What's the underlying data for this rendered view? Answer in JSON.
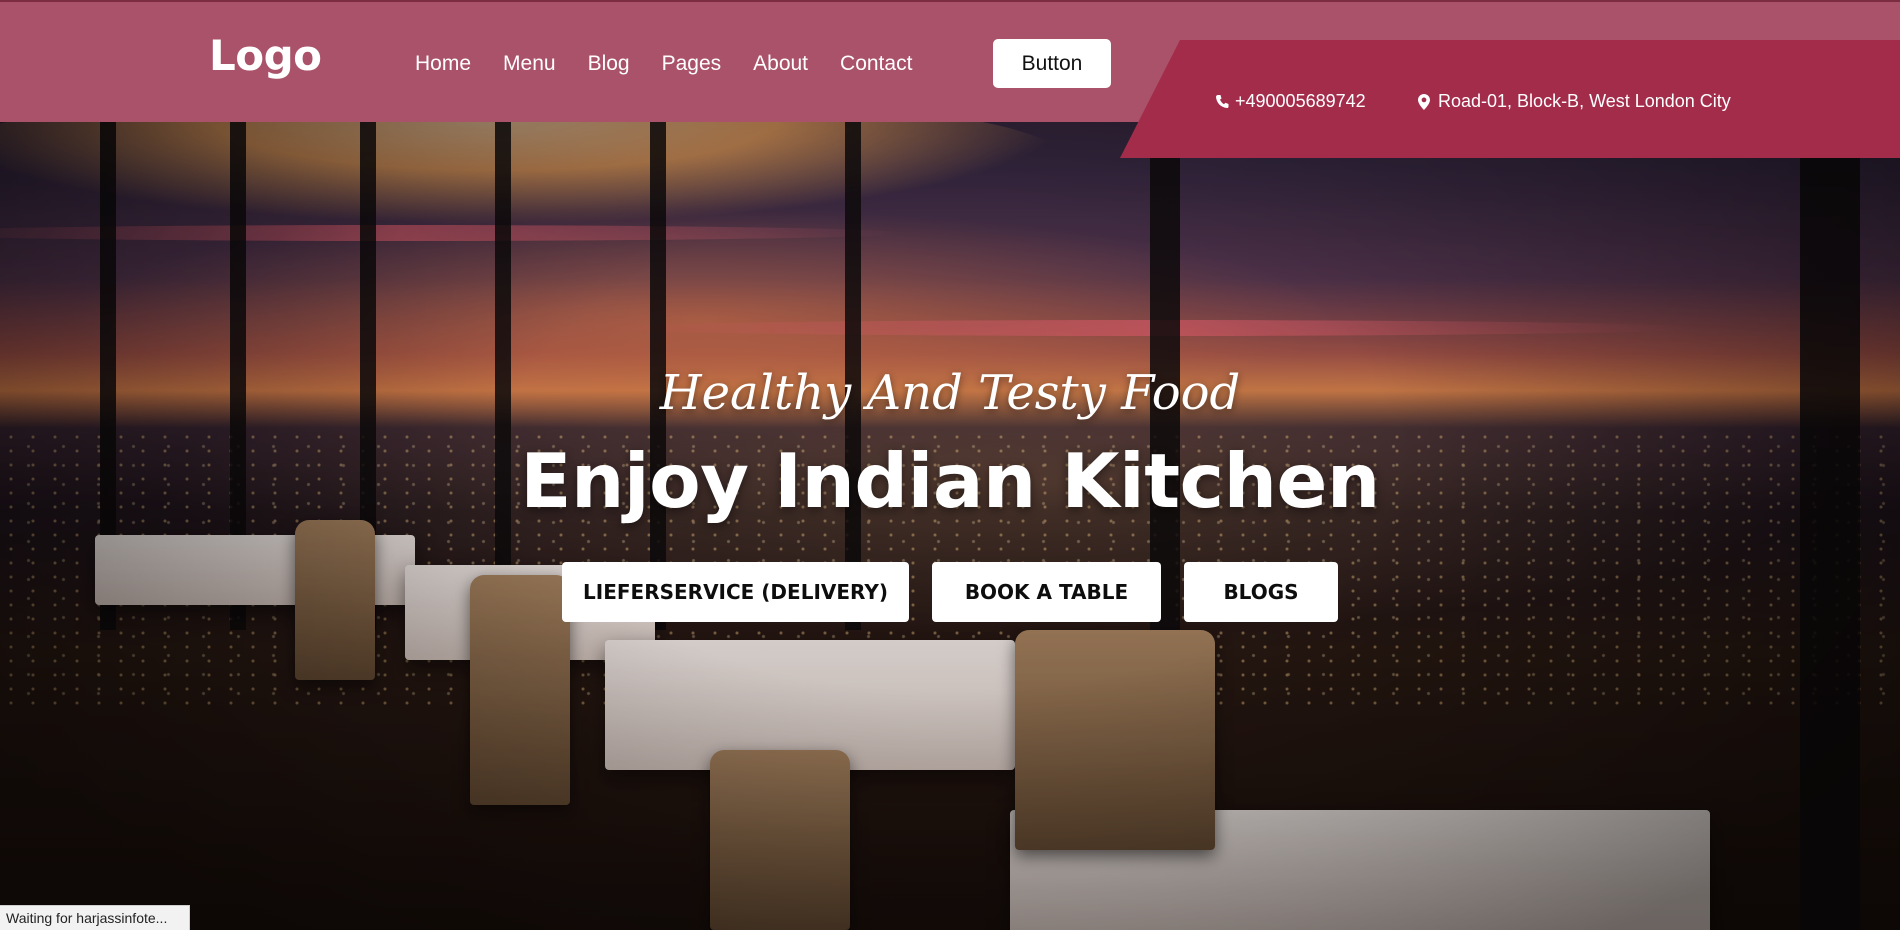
{
  "header": {
    "logo": "Logo",
    "nav": [
      "Home",
      "Menu",
      "Blog",
      "Pages",
      "About",
      "Contact"
    ],
    "button_label": "Button",
    "phone": "+490005689742",
    "address": "Road-01, Block-B, West London City"
  },
  "hero": {
    "tagline": "Healthy And Testy Food",
    "headline": "Enjoy Indian Kitchen",
    "buttons": [
      "LIEFERSERVICE (DELIVERY)",
      "BOOK A TABLE",
      "BLOGS"
    ]
  },
  "status_bar": {
    "text": "Waiting for harjassinfote..."
  },
  "colors": {
    "header_bg": "#a9526a",
    "contact_band": "#a32c4b",
    "button_bg": "#ffffff",
    "text_light": "#ffffff"
  },
  "icons": [
    "phone-icon",
    "map-pin-icon"
  ]
}
